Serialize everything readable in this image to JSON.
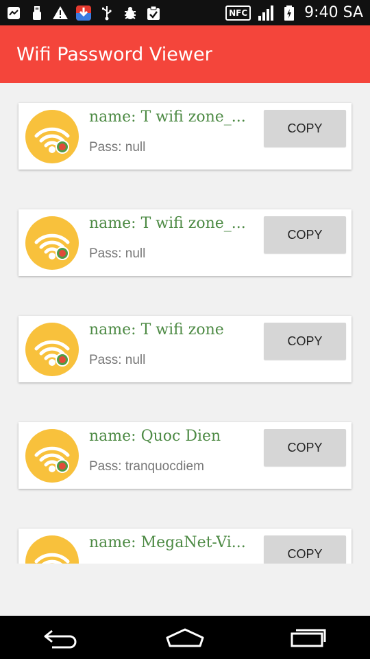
{
  "status_bar": {
    "nfc_label": "NFC",
    "time": "9:40 SA",
    "icons_left": [
      "messenger-icon",
      "usb-icon",
      "warning-icon",
      "download-icon",
      "usb-debug-icon",
      "bug-icon",
      "clipboard-check-icon"
    ],
    "icons_right": [
      "nfc-icon",
      "signal-icon",
      "battery-icon"
    ]
  },
  "app_bar": {
    "title": "Wifi Password Viewer"
  },
  "networks": [
    {
      "name": "name: T wifi zone_...",
      "pass": "Pass: null",
      "button": "COPY"
    },
    {
      "name": "name: T wifi zone_...",
      "pass": "Pass: null",
      "button": "COPY"
    },
    {
      "name": "name: T wifi zone",
      "pass": "Pass: null",
      "button": "COPY"
    },
    {
      "name": "name: Quoc Dien",
      "pass": "Pass: tranquocdiem",
      "button": "COPY"
    },
    {
      "name": "name: MegaNet-Vi...",
      "pass": "",
      "button": "COPY"
    }
  ],
  "colors": {
    "accent": "#f4453b",
    "name_text": "#4d8a44",
    "avatar": "#f8c13c",
    "button": "#d6d6d6"
  },
  "nav_bar": {
    "icons": [
      "back-icon",
      "home-icon",
      "recent-apps-icon"
    ]
  }
}
